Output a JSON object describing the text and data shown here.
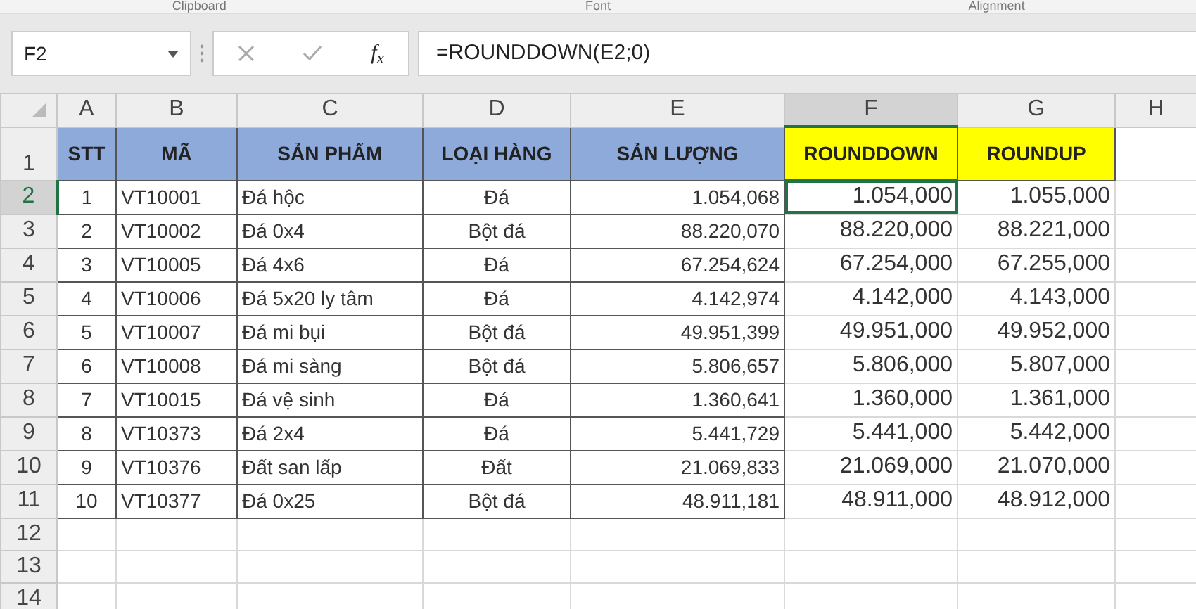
{
  "ribbon_groups": [
    "Clipboard",
    "Font",
    "Alignment"
  ],
  "formula_bar": {
    "name_box": "F2",
    "function_label": "f$_{x}$",
    "formula": "=ROUNDDOWN(E2;0)"
  },
  "columns": [
    {
      "letter": "A",
      "selected": false
    },
    {
      "letter": "B",
      "selected": false
    },
    {
      "letter": "C",
      "selected": false
    },
    {
      "letter": "D",
      "selected": false
    },
    {
      "letter": "E",
      "selected": false
    },
    {
      "letter": "F",
      "selected": true
    },
    {
      "letter": "G",
      "selected": false
    },
    {
      "letter": "H",
      "selected": false
    }
  ],
  "header_row": {
    "row_number": "1",
    "cells": [
      {
        "text": "STT",
        "color": "#8eaadb"
      },
      {
        "text": "MÃ",
        "color": "#8eaadb"
      },
      {
        "text": "SẢN PHẨM",
        "color": "#8eaadb"
      },
      {
        "text": "LOẠI HÀNG",
        "color": "#8eaadb"
      },
      {
        "text": "SẢN LƯỢNG",
        "color": "#8eaadb"
      },
      {
        "text": "ROUNDDOWN",
        "color": "#ffff00"
      },
      {
        "text": "ROUNDUP",
        "color": "#ffff00"
      }
    ]
  },
  "rows": [
    {
      "row_number": "2",
      "selected": true,
      "cells": [
        "1",
        "VT10001",
        "Đá hộc",
        "Đá",
        "1.054,068",
        "1.054,000",
        "1.055,000"
      ]
    },
    {
      "row_number": "3",
      "selected": false,
      "cells": [
        "2",
        "VT10002",
        "Đá 0x4",
        "Bột đá",
        "88.220,070",
        "88.220,000",
        "88.221,000"
      ]
    },
    {
      "row_number": "4",
      "selected": false,
      "cells": [
        "3",
        "VT10005",
        "Đá 4x6",
        "Đá",
        "67.254,624",
        "67.254,000",
        "67.255,000"
      ]
    },
    {
      "row_number": "5",
      "selected": false,
      "cells": [
        "4",
        "VT10006",
        "Đá 5x20 ly tâm",
        "Đá",
        "4.142,974",
        "4.142,000",
        "4.143,000"
      ]
    },
    {
      "row_number": "6",
      "selected": false,
      "cells": [
        "5",
        "VT10007",
        "Đá mi bụi",
        "Bột đá",
        "49.951,399",
        "49.951,000",
        "49.952,000"
      ]
    },
    {
      "row_number": "7",
      "selected": false,
      "cells": [
        "6",
        "VT10008",
        "Đá mi sàng",
        "Bột đá",
        "5.806,657",
        "5.806,000",
        "5.807,000"
      ]
    },
    {
      "row_number": "8",
      "selected": false,
      "cells": [
        "7",
        "VT10015",
        "Đá vệ sinh",
        "Đá",
        "1.360,641",
        "1.360,000",
        "1.361,000"
      ]
    },
    {
      "row_number": "9",
      "selected": false,
      "cells": [
        "8",
        "VT10373",
        "Đá 2x4",
        "Đá",
        "5.441,729",
        "5.441,000",
        "5.442,000"
      ]
    },
    {
      "row_number": "10",
      "selected": false,
      "cells": [
        "9",
        "VT10376",
        "Đất san lấp",
        "Đất",
        "21.069,833",
        "21.069,000",
        "21.070,000"
      ]
    },
    {
      "row_number": "11",
      "selected": false,
      "cells": [
        "10",
        "VT10377",
        "Đá 0x25",
        "Bột đá",
        "48.911,181",
        "48.911,000",
        "48.912,000"
      ]
    }
  ],
  "empty_rows": [
    "12",
    "13",
    "14"
  ]
}
